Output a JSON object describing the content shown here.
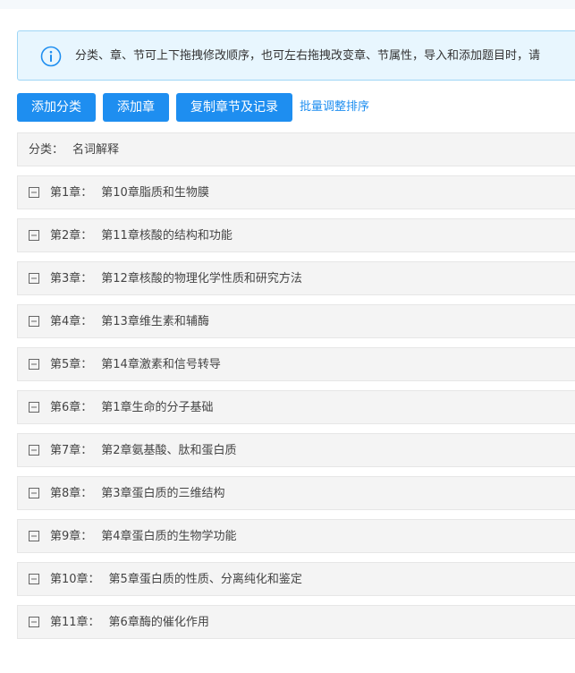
{
  "notice": {
    "icon": "info-icon",
    "text": "分类、章、节可上下拖拽修改顺序，也可左右拖拽改变章、节属性，导入和添加题目时，请"
  },
  "toolbar": {
    "add_category_label": "添加分类",
    "add_chapter_label": "添加章",
    "copy_chapter_label": "复制章节及记录",
    "batch_sort_label": "批量调整排序"
  },
  "category": {
    "prefix": "分类：",
    "name": "名词解释"
  },
  "chapters": [
    {
      "number": "第1章：",
      "title": "第10章脂质和生物膜"
    },
    {
      "number": "第2章：",
      "title": "第11章核酸的结构和功能"
    },
    {
      "number": "第3章：",
      "title": "第12章核酸的物理化学性质和研究方法"
    },
    {
      "number": "第4章：",
      "title": "第13章维生素和辅酶"
    },
    {
      "number": "第5章：",
      "title": "第14章激素和信号转导"
    },
    {
      "number": "第6章：",
      "title": "第1章生命的分子基础"
    },
    {
      "number": "第7章：",
      "title": "第2章氨基酸、肽和蛋白质"
    },
    {
      "number": "第8章：",
      "title": "第3章蛋白质的三维结构"
    },
    {
      "number": "第9章：",
      "title": "第4章蛋白质的生物学功能"
    },
    {
      "number": "第10章：",
      "title": "第5章蛋白质的性质、分离纯化和鉴定"
    },
    {
      "number": "第11章：",
      "title": "第6章酶的催化作用"
    }
  ],
  "colors": {
    "primary": "#1e8ef0",
    "notice_bg": "#e8f6fe",
    "notice_border": "#9fd6f6",
    "row_bg": "#f4f4f4"
  }
}
